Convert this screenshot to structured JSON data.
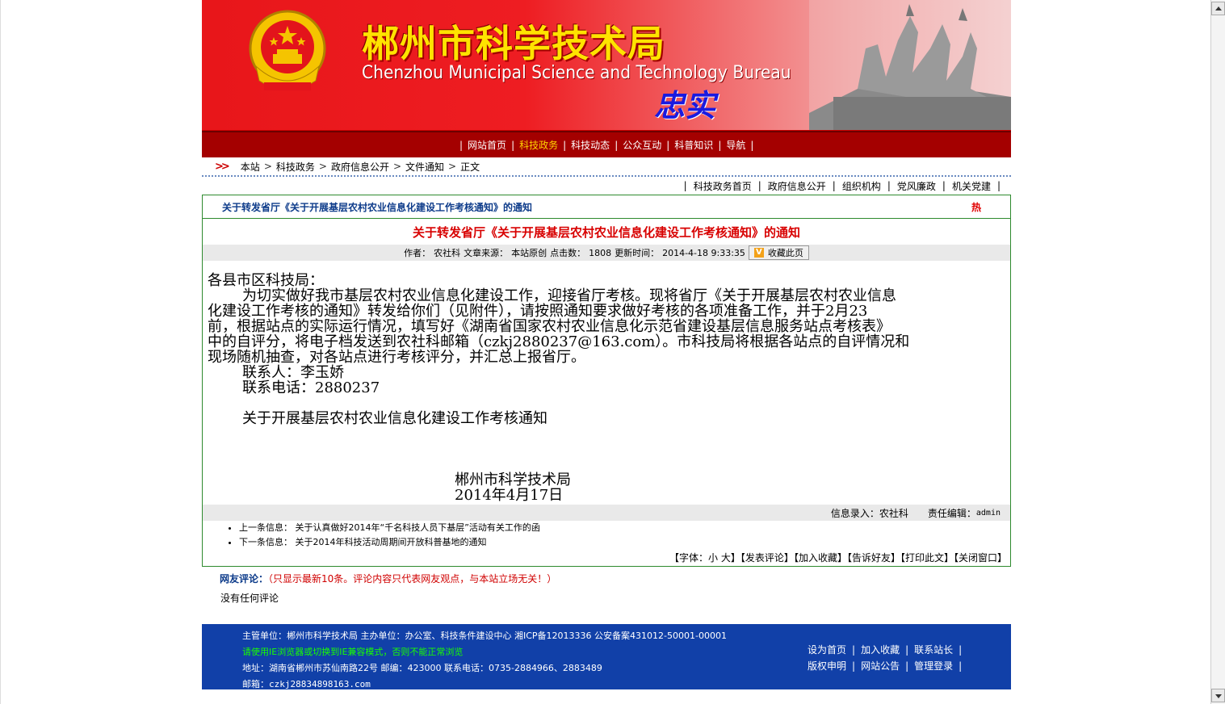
{
  "banner": {
    "title_cn": "郴州市科学技术局",
    "title_en": "Chenzhou Municipal  Science and Technology Bureau",
    "motto": "忠实"
  },
  "nav": {
    "items": [
      {
        "label": "网站首页"
      },
      {
        "label": "科技政务"
      },
      {
        "label": "科技动态"
      },
      {
        "label": "公众互动"
      },
      {
        "label": "科普知识"
      },
      {
        "label": "导航"
      }
    ],
    "active_index": 1
  },
  "breadcrumb": {
    "items": [
      "本站",
      "科技政务",
      "政府信息公开",
      "文件通知",
      "正文"
    ]
  },
  "subnav": {
    "items": [
      "科技政务首页",
      "政府信息公开",
      "组织机构",
      "党风廉政",
      "机关党建"
    ]
  },
  "article": {
    "head_title": "关于转发省厅《关于开展基层农村农业信息化建设工作考核通知》的通知",
    "hot_label": "热",
    "title": "关于转发省厅《关于开展基层农村农业信息化建设工作考核通知》的通知",
    "meta": {
      "author_label": "作者：",
      "author": "农社科",
      "source_label": "文章来源：",
      "source": "本站原创",
      "hits_label": "点击数：",
      "hits": "1808",
      "updated_label": "更新时间：",
      "updated": "2014-4-18 9:33:35",
      "fav_label": "收藏此页"
    },
    "body": {
      "salutation": "各县市区科技局：",
      "paragraph": "为切实做好我市基层农村农业信息化建设工作，迎接省厅考核。现将省厅《关于开展基层农村农业信息",
      "paragraph_cont": [
        "化建设工作考核的通知》转发给你们（见附件），请按照通知要求做好考核的各项准备工作，并于2月23",
        "前，根据站点的实际运行情况，填写好《湖南省国家农村农业信息化示范省建设基层信息服务站点考核表》",
        "中的自评分，将电子档发送到农社科邮箱（czkj2880237@163.com）。市科技局将根据各站点的自评情况和",
        "现场随机抽查，对各站点进行考核评分，并汇总上报省厅。"
      ],
      "contact": "联系人：李玉娇",
      "phone": "联系电话：2880237",
      "attachment": "关于开展基层农村农业信息化建设工作考核通知",
      "sign_org": "郴州市科学技术局",
      "sign_date": "2014年4月17日"
    },
    "editor": {
      "entry_label": "信息录入：",
      "entry": "农社科",
      "editor_label": "责任编辑：",
      "editor": "admin"
    },
    "prev": {
      "label": "上一条信息：",
      "title": "关于认真做好2014年“千名科技人员下基层”活动有关工作的函"
    },
    "next": {
      "label": "下一条信息：",
      "title": "关于2014年科技活动周期间开放科普基地的通知"
    },
    "tools": {
      "font_prefix": "【字体：",
      "font_small": "小",
      "font_big": "大",
      "font_suffix": "】",
      "comment": "【发表评论】",
      "favorite": "【加入收藏】",
      "tell": "【告诉好友】",
      "print": "【打印此文】",
      "close": "【关闭窗口】"
    }
  },
  "comments": {
    "label": "网友评论：",
    "note": "（只显示最新10条。评论内容只代表网友观点，与本站立场无关！）",
    "empty": "没有任何评论"
  },
  "footer": {
    "line1": "主管单位：郴州市科学技术局 主办单位：办公室、科技条件建设中心 湘ICP备12013336 公安备案431012-50001-00001",
    "warning": "请使用IE浏览器或切换到IE兼容模式，否则不能正常浏览",
    "line3": "地址：湖南省郴州市苏仙南路22号 邮编：423000 联系电话：0735-2884966、2883489",
    "email_label": "邮箱：",
    "email": "czkj28834898163.com",
    "links_row1": [
      "设为首页",
      "加入收藏",
      "联系站长"
    ],
    "links_row2": [
      "版权申明",
      "网站公告",
      "管理登录"
    ]
  },
  "colors": {
    "nav_bg": "#a40000",
    "title_red": "#d80000",
    "box_green": "#2e8a2e",
    "footer_blue": "#1140a8",
    "footer_warning": "#19ff00"
  }
}
